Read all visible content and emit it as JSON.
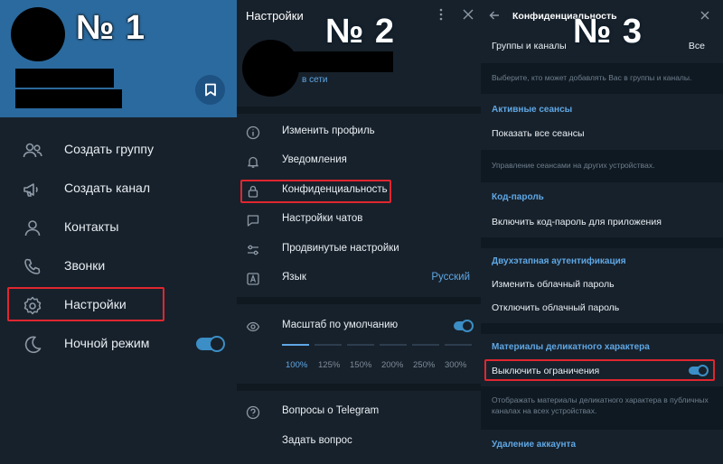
{
  "labels": {
    "n1": "№ 1",
    "n2": "№ 2",
    "n3": "№ 3"
  },
  "panel1": {
    "menu": [
      {
        "label": "Создать группу",
        "icon": "users-icon"
      },
      {
        "label": "Создать канал",
        "icon": "megaphone-icon"
      },
      {
        "label": "Контакты",
        "icon": "contact-icon"
      },
      {
        "label": "Звонки",
        "icon": "phone-icon"
      },
      {
        "label": "Настройки",
        "icon": "gear-icon"
      },
      {
        "label": "Ночной режим",
        "icon": "moon-icon"
      }
    ],
    "night_mode_on": true
  },
  "panel2": {
    "title": "Настройки",
    "status": "в сети",
    "items": [
      {
        "label": "Изменить профиль",
        "icon": "info-icon"
      },
      {
        "label": "Уведомления",
        "icon": "bell-icon"
      },
      {
        "label": "Конфиденциальность",
        "icon": "lock-icon"
      },
      {
        "label": "Настройки чатов",
        "icon": "chat-icon"
      },
      {
        "label": "Продвинутые настройки",
        "icon": "sliders-icon"
      },
      {
        "label": "Язык",
        "icon": "language-icon",
        "value": "Русский"
      }
    ],
    "scale": {
      "label": "Масштаб по умолчанию",
      "enabled": true,
      "options": [
        "100%",
        "125%",
        "150%",
        "200%",
        "250%",
        "300%"
      ],
      "selected": "100%"
    },
    "help": [
      {
        "label": "Вопросы о Telegram",
        "icon": "question-icon"
      },
      {
        "label": "Задать вопрос"
      }
    ]
  },
  "panel3": {
    "title": "Конфиденциальность",
    "groups_label": "Группы и каналы",
    "groups_value": "Все",
    "groups_hint": "Выберите, кто может добавлять Вас в группы и каналы.",
    "sessions_header": "Активные сеансы",
    "sessions_show": "Показать все сеансы",
    "sessions_hint": "Управление сеансами на других устройствах.",
    "passcode_header": "Код-пароль",
    "passcode_enable": "Включить код-пароль для приложения",
    "twofa_header": "Двухэтапная аутентификация",
    "twofa_change": "Изменить облачный пароль",
    "twofa_disable": "Отключить облачный пароль",
    "sensitive_header": "Материалы деликатного характера",
    "sensitive_toggle": "Выключить ограничения",
    "sensitive_on": true,
    "sensitive_hint": "Отображать материалы деликатного характера в публичных каналах на всех устройствах.",
    "delete_header": "Удаление аккаунта"
  },
  "colors": {
    "accent": "#5fa7e4",
    "highlight": "#e0262f",
    "header": "#2b6a9e",
    "bg": "#17212b"
  }
}
